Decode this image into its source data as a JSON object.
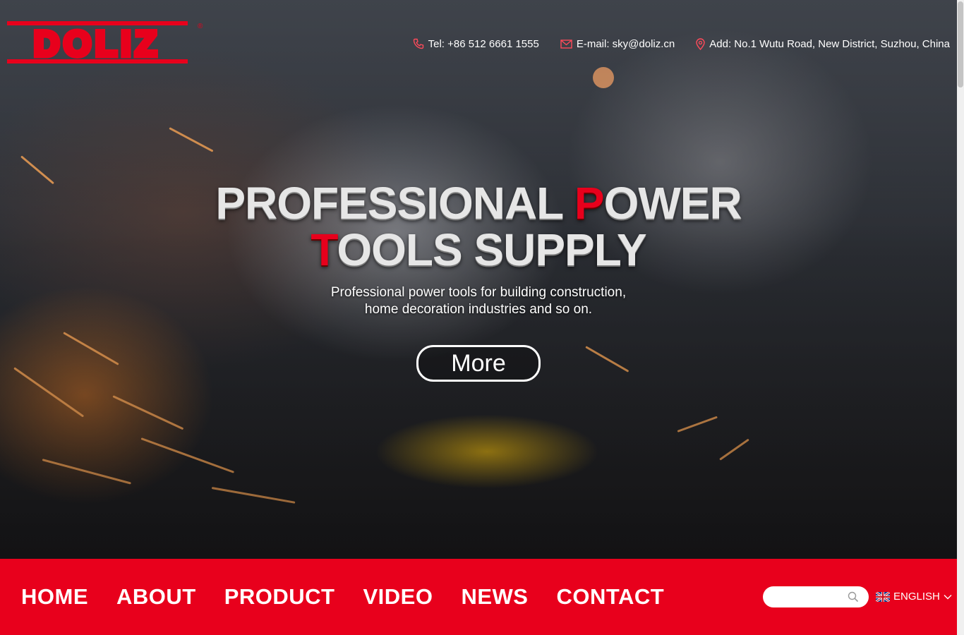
{
  "brand": {
    "logo_text": "DOLIZ",
    "color": "#e8001c"
  },
  "contact": {
    "tel": "Tel: +86 512 6661 1555",
    "email": "E-mail: sky@doliz.cn",
    "address": "Add: No.1 Wutu Road, New District, Suzhou, China",
    "icons": [
      "phone-icon",
      "mail-icon",
      "location-pin-icon"
    ]
  },
  "hero": {
    "title_line1_part1": "PROFESSIONAL ",
    "title_line1_red": "P",
    "title_line1_part2": "OWER",
    "title_line2_red": "T",
    "title_line2_part2": "OOLS SUPPLY",
    "subtitle_line1": "Professional power tools for building construction,",
    "subtitle_line2": "home decoration industries and so on.",
    "more_label": "More"
  },
  "nav": {
    "items": [
      {
        "label": "HOME"
      },
      {
        "label": "ABOUT"
      },
      {
        "label": "PRODUCT"
      },
      {
        "label": "VIDEO"
      },
      {
        "label": "NEWS"
      },
      {
        "label": "CONTACT"
      }
    ],
    "search_placeholder": "",
    "language": "ENGLISH",
    "bar_color": "#e8001c"
  }
}
